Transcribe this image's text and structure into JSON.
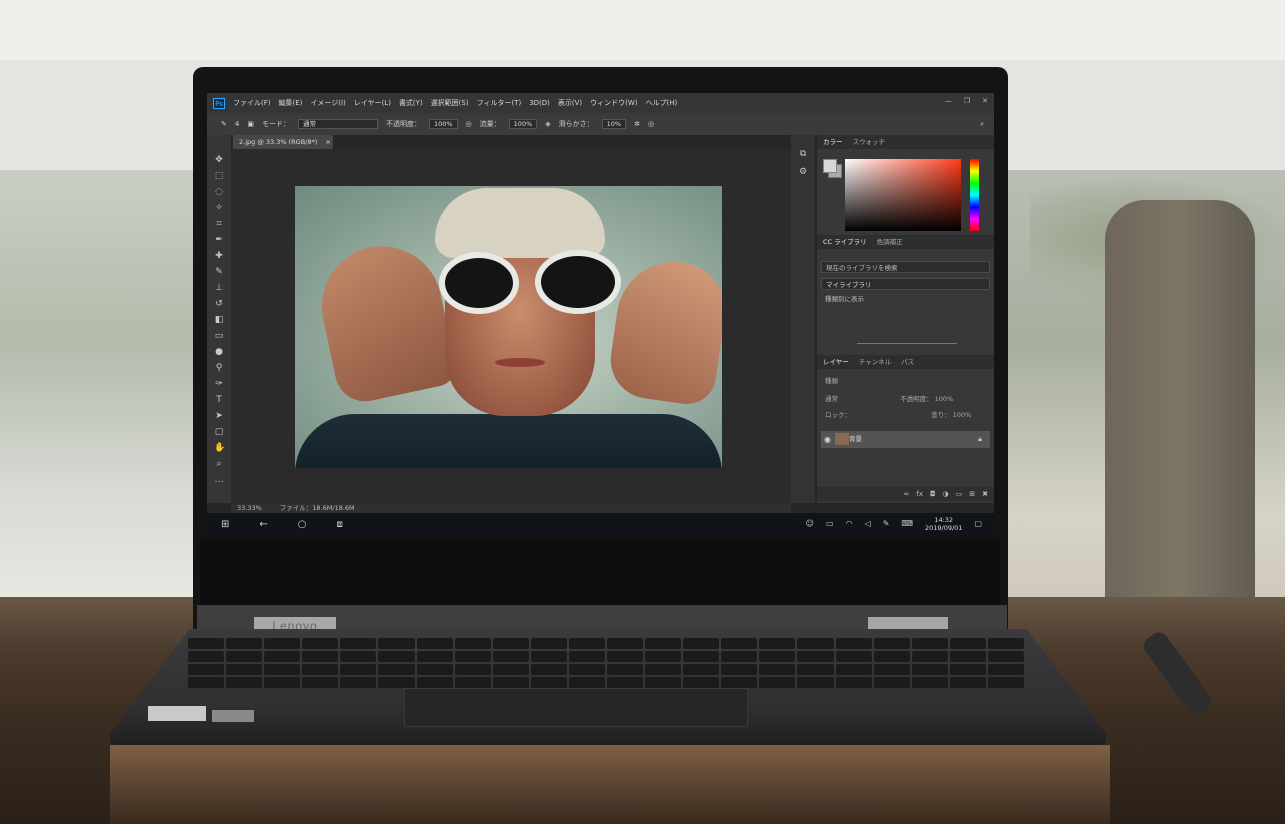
{
  "app": {
    "logo": "Ps",
    "menu": [
      "ファイル(F)",
      "編集(E)",
      "イメージ(I)",
      "レイヤー(L)",
      "書式(Y)",
      "選択範囲(S)",
      "フィルター(T)",
      "3D(D)",
      "表示(V)",
      "ウィンドウ(W)",
      "ヘルプ(H)"
    ],
    "window_controls": [
      "—",
      "❐",
      "✕"
    ]
  },
  "options": {
    "brush_size": "4",
    "mode_label": "モード：",
    "mode_value": "通常",
    "opacity_label": "不透明度：",
    "opacity_value": "100%",
    "flow_label": "流量：",
    "flow_value": "100%",
    "smoothing_label": "滑らかさ：",
    "smoothing_value": "10%"
  },
  "document": {
    "tab_title": "2.jpg @ 33.3% (RGB/8*)",
    "close": "×",
    "zoom": "33.33%",
    "file_info": "ファイル：18.6M/18.6M"
  },
  "panels": {
    "color_tabs": [
      "カラー",
      "スウォッチ"
    ],
    "library_tabs": [
      "CC ライブラリ",
      "色調補正"
    ],
    "library_search_placeholder": "現在のライブラリを検索",
    "library_selected": "マイライブラリ",
    "library_view": "種類別に表示",
    "layers_tabs": [
      "レイヤー",
      "チャンネル",
      "パス"
    ],
    "layers_kind": "種類",
    "blend_mode": "通常",
    "opacity_label": "不透明度：",
    "opacity_value": "100%",
    "lock_label": "ロック：",
    "fill_label": "塗り：",
    "fill_value": "100%",
    "layer_name": "背景"
  },
  "taskbar": {
    "time": "14:32",
    "date": "2019/09/01"
  },
  "device": {
    "brand": "Lenovo"
  },
  "colors": {
    "ps_accent": "#31a8ff",
    "ps_panel": "#383838",
    "taskbar": "#101418"
  }
}
